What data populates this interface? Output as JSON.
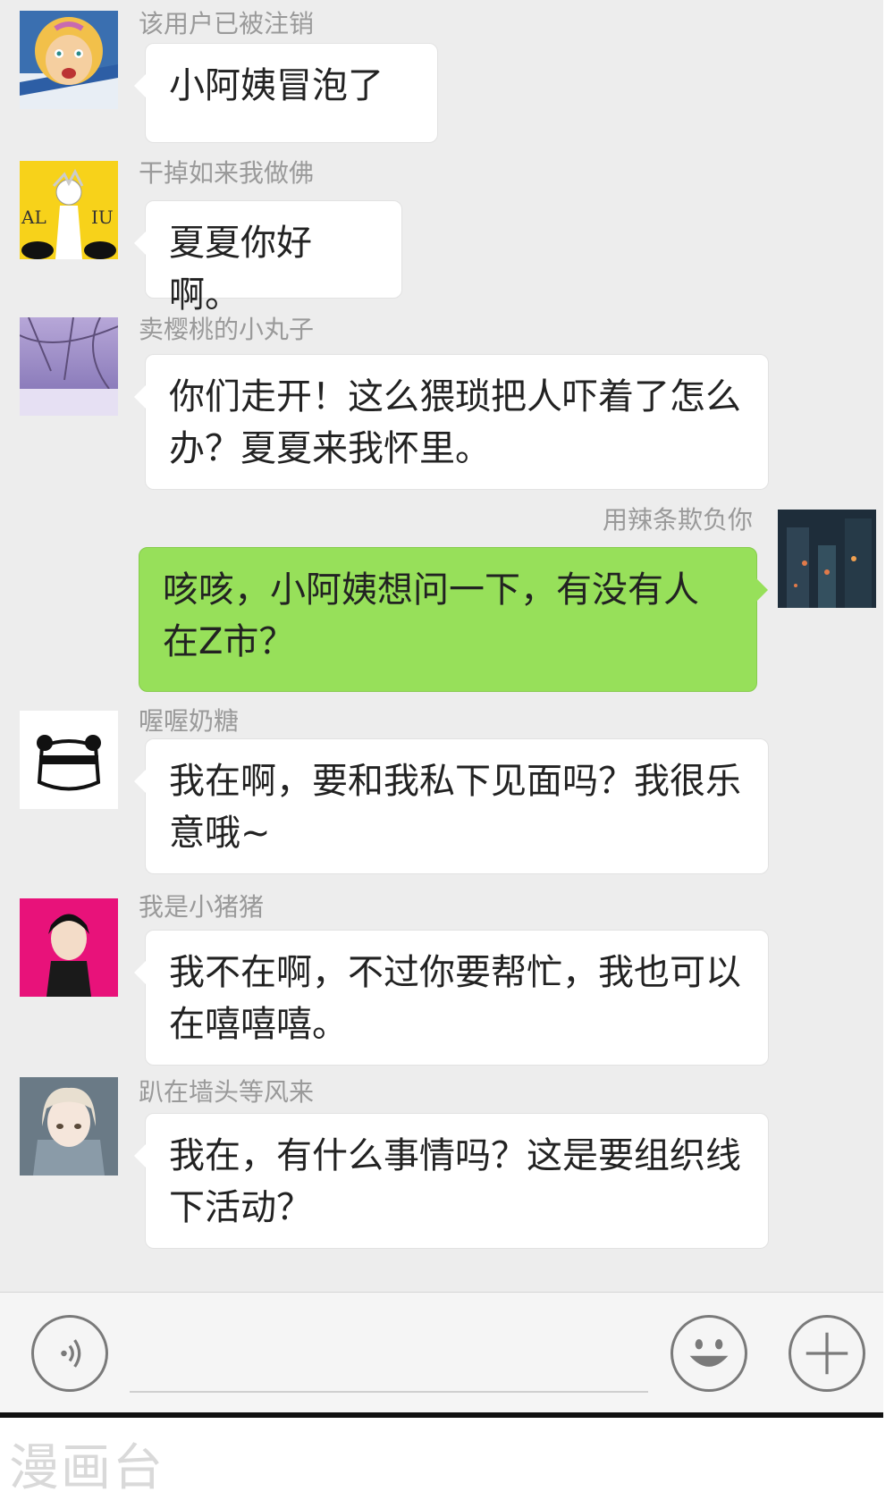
{
  "messages": [
    {
      "sender": "该用户已被注销",
      "text": "小阿姨冒泡了",
      "avatar": "cartoon-girl-avatar"
    },
    {
      "sender": "干掉如来我做佛",
      "text": "夏夏你好啊。",
      "avatar": "anime-boy-yellow-avatar"
    },
    {
      "sender": "卖樱桃的小丸子",
      "text": "你们走开！这么猥琐把人吓着了怎么办？夏夏来我怀里。",
      "avatar": "winter-tree-avatar"
    },
    {
      "sender": "用辣条欺负你",
      "text": "咳咳，小阿姨想问一下，有没有人在Z市？",
      "avatar": "night-city-avatar",
      "self": true
    },
    {
      "sender": "喔喔奶糖",
      "text": "我在啊，要和我私下见面吗？我很乐意哦~",
      "avatar": "panda-avatar"
    },
    {
      "sender": "我是小猪猪",
      "text": "我不在啊，不过你要帮忙，我也可以在嘻嘻嘻。",
      "avatar": "anime-boy-pink-avatar"
    },
    {
      "sender": "趴在墙头等风来",
      "text": "我在，有什么事情吗？这是要组织线下活动？",
      "avatar": "anime-girl-uniform-avatar"
    }
  ],
  "toolbar": {
    "voice_icon": "voice-icon",
    "emoji_icon": "emoji-icon",
    "plus_icon": "plus-icon"
  },
  "watermark": "漫画台",
  "colors": {
    "chat_bg": "#ededed",
    "self_bubble": "#97e05a",
    "other_bubble": "#ffffff",
    "name_text": "#9a9a9a"
  }
}
